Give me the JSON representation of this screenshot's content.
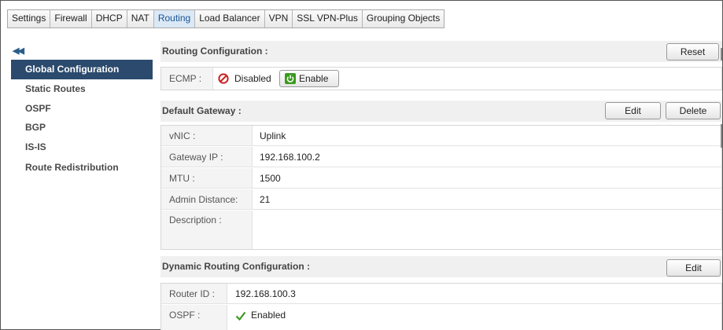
{
  "tabs": [
    "Settings",
    "Firewall",
    "DHCP",
    "NAT",
    "Routing",
    "Load Balancer",
    "VPN",
    "SSL VPN-Plus",
    "Grouping Objects"
  ],
  "active_tab": "Routing",
  "sidebar": {
    "collapse_icon": "double-chevron-left-icon",
    "items": [
      {
        "label": "Global Configuration"
      },
      {
        "label": "Static Routes"
      },
      {
        "label": "OSPF"
      },
      {
        "label": "BGP"
      },
      {
        "label": "IS-IS"
      },
      {
        "label": "Route Redistribution"
      }
    ]
  },
  "routing_config": {
    "title": "Routing Configuration :",
    "reset_label": "Reset",
    "ecmp_label": "ECMP :",
    "ecmp_status": "Disabled",
    "enable_label": "Enable"
  },
  "default_gateway": {
    "title": "Default Gateway :",
    "edit_label": "Edit",
    "delete_label": "Delete",
    "rows": [
      {
        "label": "vNIC :",
        "value": "Uplink"
      },
      {
        "label": "Gateway IP :",
        "value": "192.168.100.2"
      },
      {
        "label": "MTU :",
        "value": "1500"
      },
      {
        "label": "Admin Distance:",
        "value": "21"
      },
      {
        "label": "Description :",
        "value": ""
      }
    ]
  },
  "dynamic_routing": {
    "title": "Dynamic Routing Configuration :",
    "edit_label": "Edit",
    "router_id_label": "Router ID :",
    "router_id": "192.168.100.3",
    "ospf_label": "OSPF :",
    "ospf_status": "Enabled"
  },
  "colors": {
    "sidebar_active": "#2b4a6d",
    "tab_active_text": "#1a5496",
    "disabled_red": "#cc2222",
    "enable_green": "#3a9a1e",
    "check_green": "#3a9a1e"
  }
}
